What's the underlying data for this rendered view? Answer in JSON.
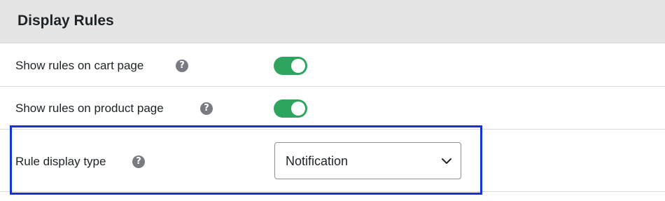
{
  "section": {
    "title": "Display Rules"
  },
  "settings": [
    {
      "label": "Show rules on cart page",
      "help_icon": "question-circle-icon",
      "control": "toggle",
      "enabled": true
    },
    {
      "label": "Show rules on product page",
      "help_icon": "question-circle-icon",
      "control": "toggle",
      "enabled": true
    },
    {
      "label": "Rule display type",
      "help_icon": "question-circle-icon",
      "control": "select",
      "selected": "Notification"
    }
  ],
  "help_glyph": "?",
  "colors": {
    "header_bg": "#e5e5e5",
    "toggle_on": "#2ea55e",
    "highlight_border": "#1035d6",
    "help_icon_bg": "#787c82"
  }
}
